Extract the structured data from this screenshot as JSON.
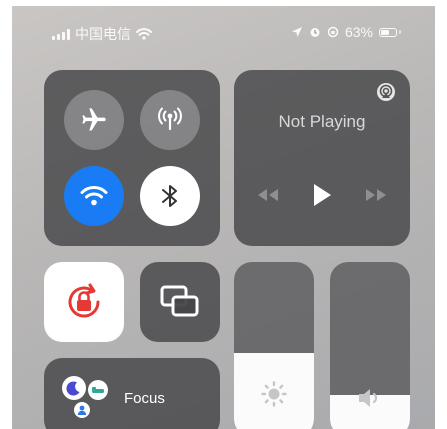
{
  "status_bar": {
    "carrier": "中国电信",
    "battery": "63%",
    "battery_level": 0.63
  },
  "connectivity": {
    "airplane": {
      "icon": "airplane-icon",
      "active": false
    },
    "cellular": {
      "icon": "cellular-antenna-icon",
      "active": false
    },
    "wifi": {
      "icon": "wifi-icon",
      "active": true
    },
    "bluetooth": {
      "icon": "bluetooth-icon",
      "active": true
    }
  },
  "media": {
    "status": "Not Playing",
    "icons": [
      "airplay-icon",
      "rewind-icon",
      "play-icon",
      "fast-forward-icon"
    ]
  },
  "controls": {
    "rotation_lock": {
      "icon": "rotation-lock-icon",
      "active": true
    },
    "screen_mirroring": {
      "icon": "screen-mirroring-icon"
    }
  },
  "sliders": {
    "brightness": {
      "icon": "brightness-icon",
      "level": 0.48
    },
    "volume": {
      "icon": "speaker-icon",
      "level": 0.24
    }
  },
  "focus": {
    "label": "Focus",
    "icons": [
      "moon-icon",
      "bed-icon",
      "person-icon"
    ]
  },
  "colors": {
    "accent_blue": "#1a7cf4",
    "lock_red": "#e53935",
    "tile": "#464648"
  }
}
